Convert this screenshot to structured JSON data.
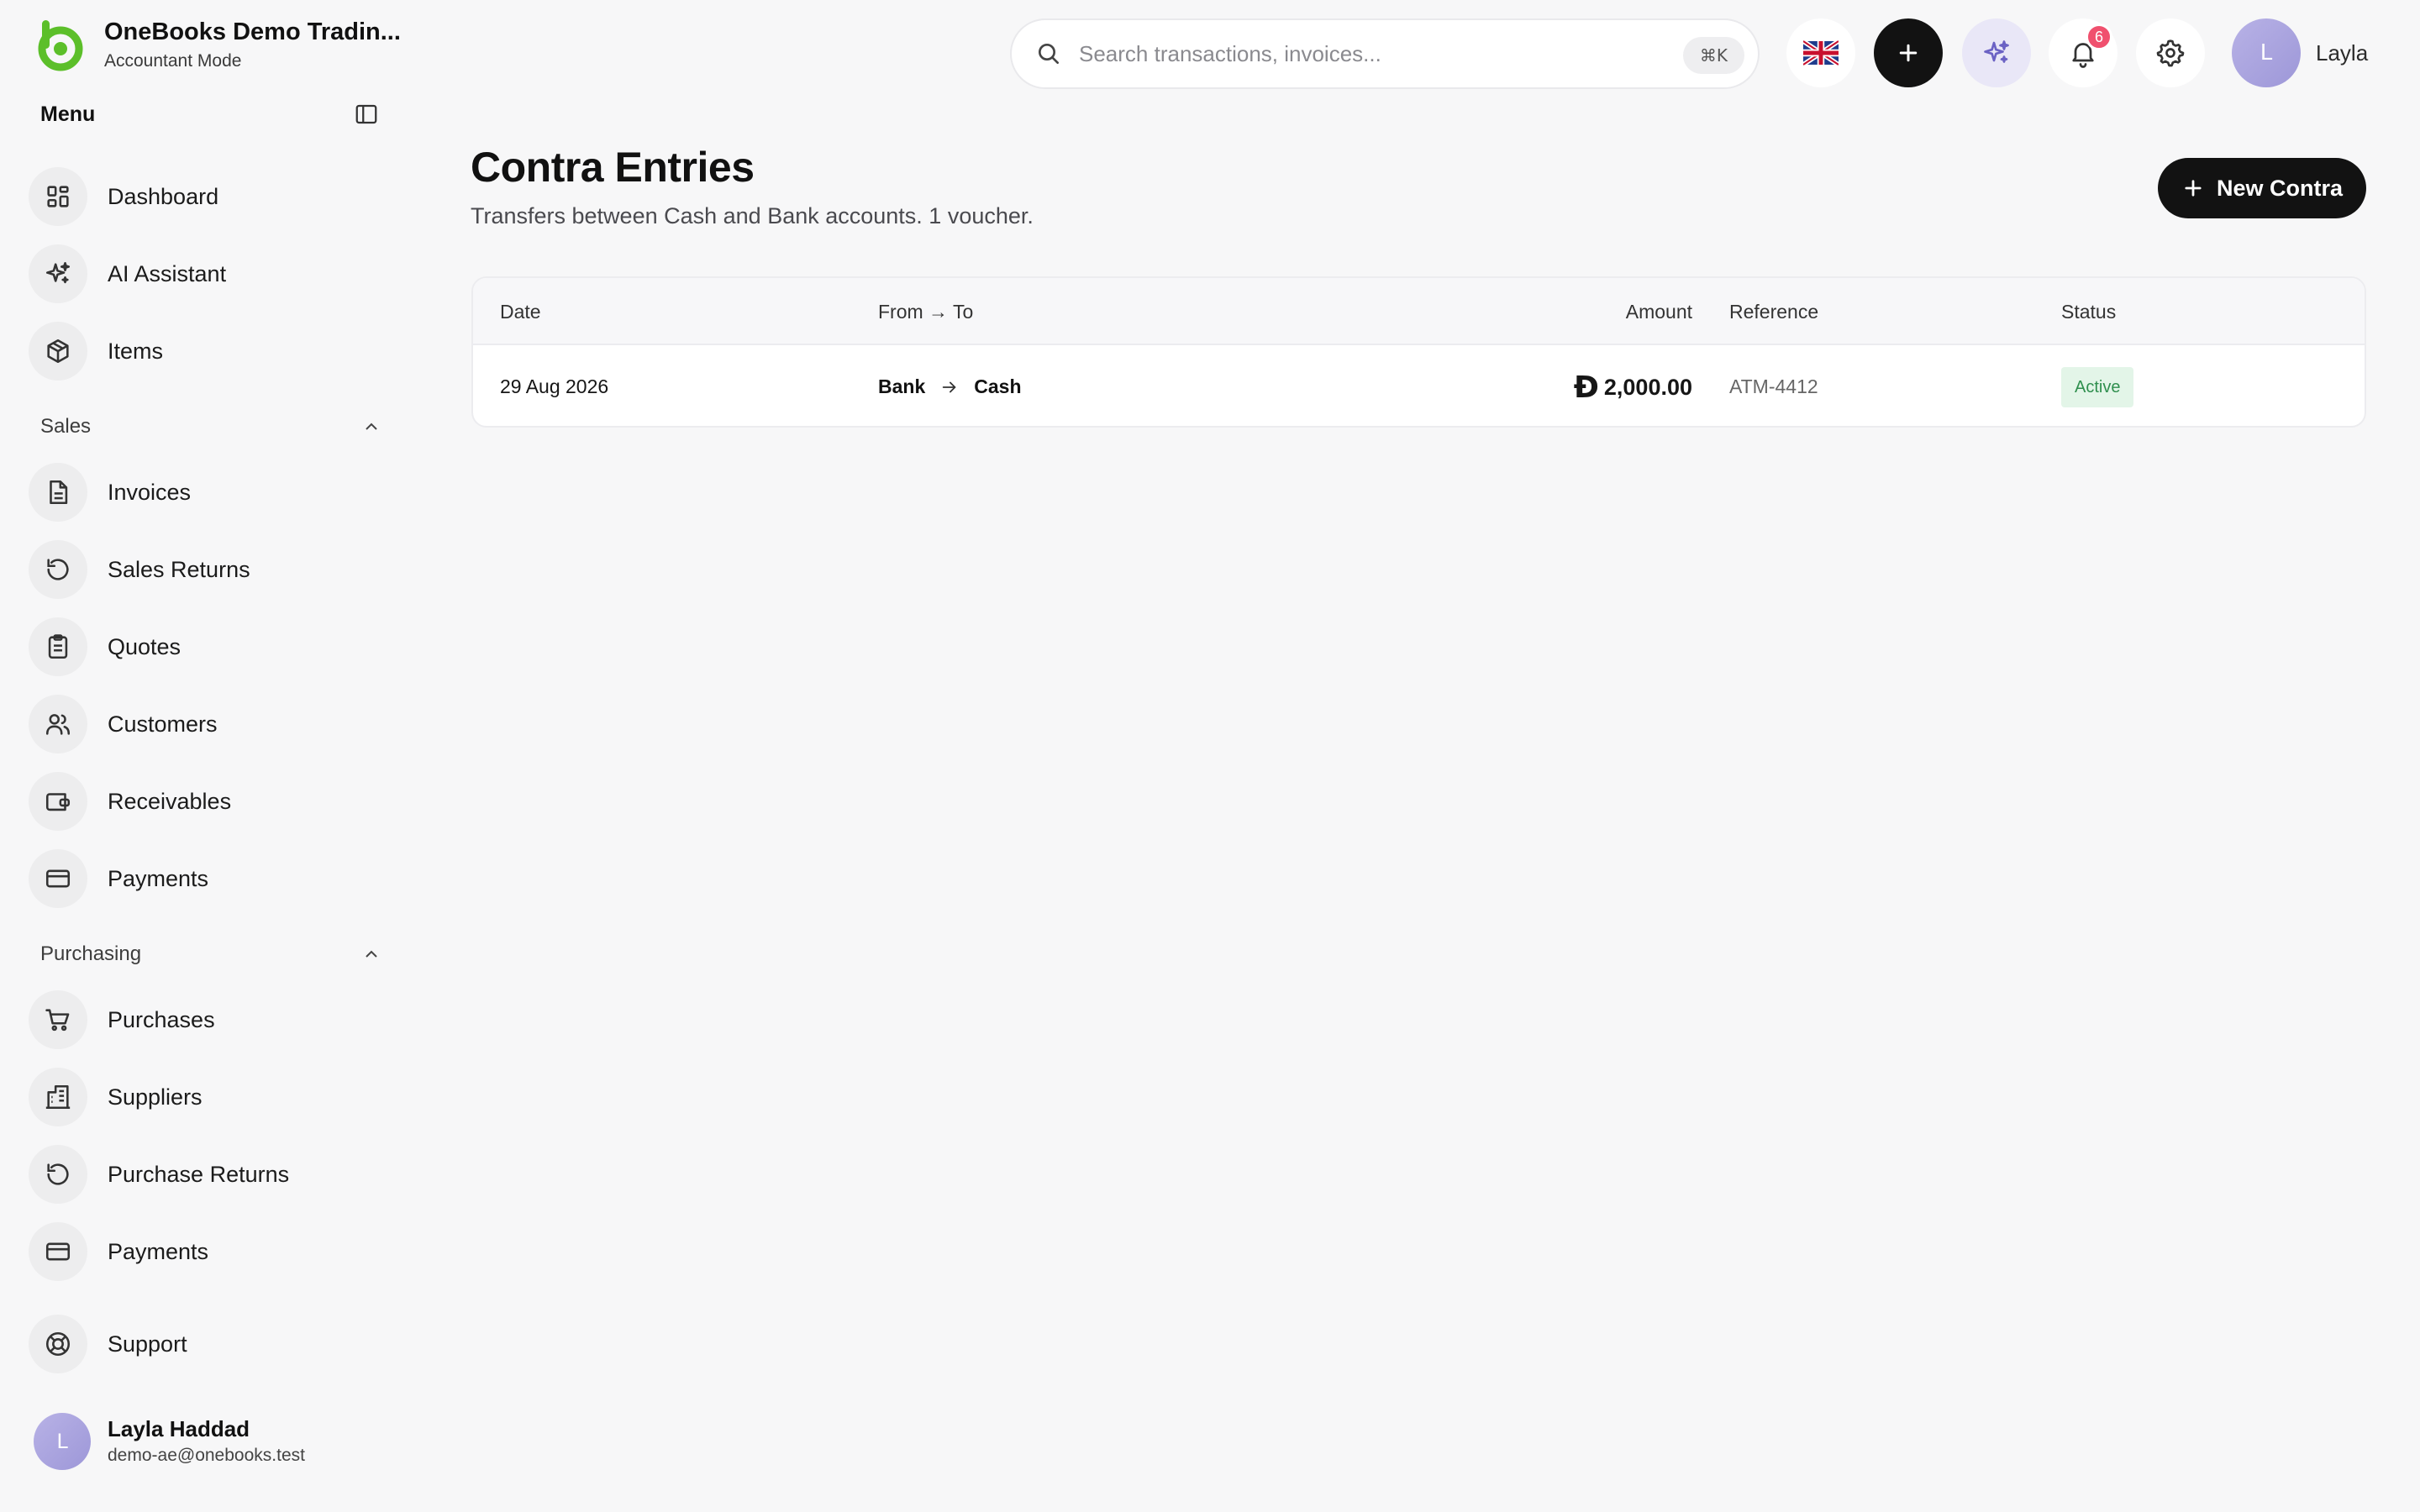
{
  "brand": {
    "name": "OneBooks Demo Tradin...",
    "mode": "Accountant Mode",
    "accent": "#5cbf2a"
  },
  "sidebar": {
    "menu_title": "Menu",
    "items_top": [
      {
        "label": "Dashboard",
        "icon": "dashboard-icon"
      },
      {
        "label": "AI Assistant",
        "icon": "sparkles-icon"
      },
      {
        "label": "Items",
        "icon": "box-icon"
      }
    ],
    "sales": {
      "title": "Sales",
      "items": [
        {
          "label": "Invoices",
          "icon": "file-icon"
        },
        {
          "label": "Sales Returns",
          "icon": "rotate-ccw-icon"
        },
        {
          "label": "Quotes",
          "icon": "clipboard-icon"
        },
        {
          "label": "Customers",
          "icon": "users-icon"
        },
        {
          "label": "Receivables",
          "icon": "wallet-icon"
        },
        {
          "label": "Payments",
          "icon": "credit-card-icon"
        }
      ]
    },
    "purchasing": {
      "title": "Purchasing",
      "items": [
        {
          "label": "Purchases",
          "icon": "cart-icon"
        },
        {
          "label": "Suppliers",
          "icon": "building-icon"
        },
        {
          "label": "Purchase Returns",
          "icon": "rotate-ccw-icon"
        },
        {
          "label": "Payments",
          "icon": "credit-card-icon"
        }
      ]
    },
    "support_label": "Support",
    "user": {
      "initial": "L",
      "name": "Layla Haddad",
      "email": "demo-ae@onebooks.test"
    }
  },
  "topbar": {
    "search_placeholder": "Search transactions, invoices...",
    "search_shortcut": "⌘K",
    "notification_count": "6",
    "profile_initial": "L",
    "profile_name": "Layla"
  },
  "main": {
    "title": "Contra Entries",
    "subtitle": "Transfers between Cash and Bank accounts. 1 voucher.",
    "new_button_label": "New Contra",
    "table": {
      "headers": {
        "date": "Date",
        "from_to": "From → To",
        "amount": "Amount",
        "reference": "Reference",
        "status": "Status"
      },
      "rows": [
        {
          "date": "29 Aug 2026",
          "from": "Bank",
          "to": "Cash",
          "currency_symbol": "Ð",
          "amount": "2,000.00",
          "reference": "ATM-4412",
          "status": "Active"
        }
      ]
    }
  },
  "colors": {
    "primary_button": "#121212",
    "status_active_bg": "#e3f5e8",
    "status_active_text": "#2f8f4e",
    "badge": "#f0506e"
  }
}
